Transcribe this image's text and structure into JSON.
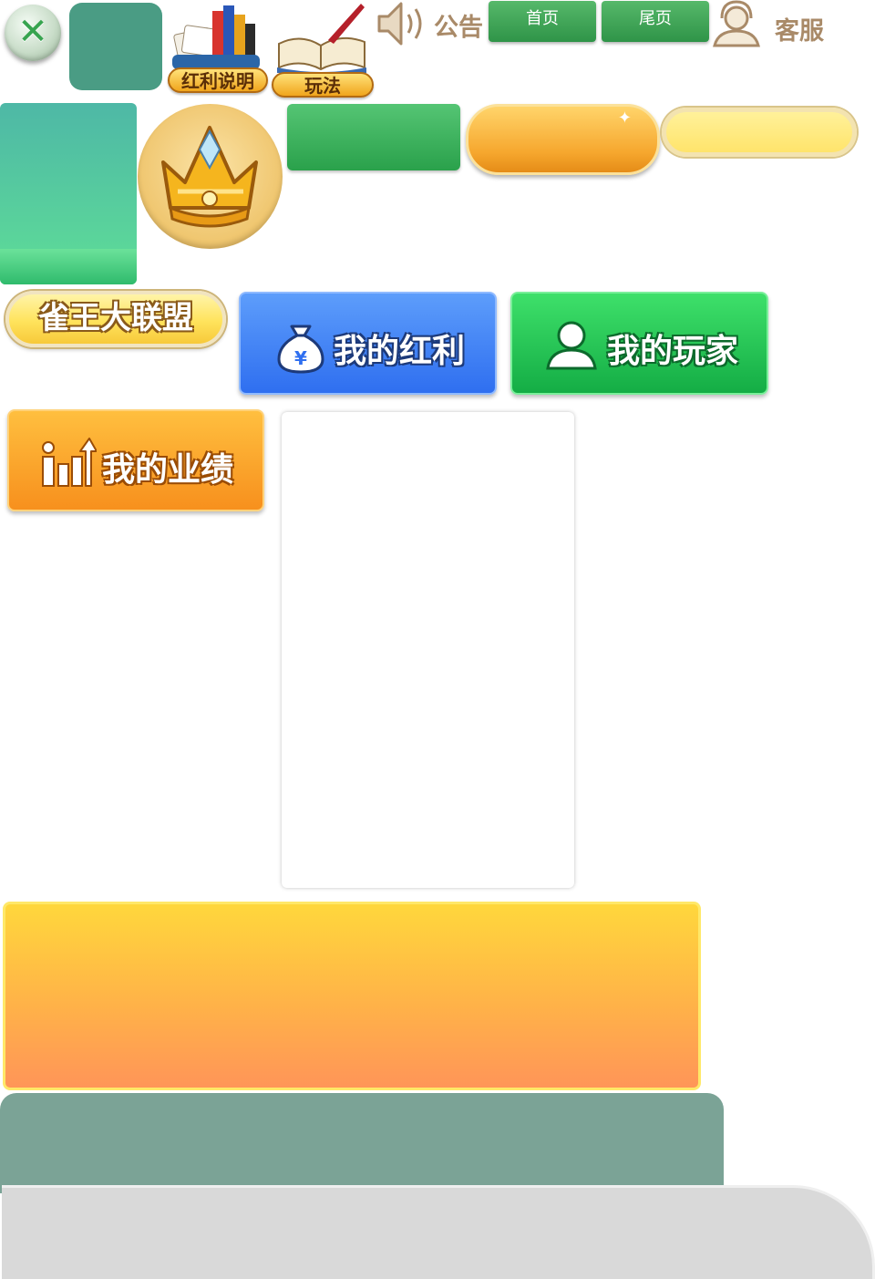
{
  "top_bar": {
    "close_icon_glyph": "✕",
    "bonus_info_label": "红利说明",
    "rules_label": "玩法",
    "notice_label": "公告",
    "home_label": "首页",
    "last_page_label": "尾页",
    "customer_service_label": "客服"
  },
  "alliance": {
    "label": "雀王大联盟"
  },
  "actions": {
    "my_bonus_label": "我的红利",
    "my_players_label": "我的玩家",
    "my_performance_label": "我的业绩"
  },
  "icons": {
    "close": "close-icon",
    "cards_chips": "cards-chips-icon",
    "book_quill": "book-quill-icon",
    "speaker": "speaker-icon",
    "customer_service": "headset-user-icon",
    "crown": "crown-icon",
    "money_bag": "money-bag-icon",
    "user": "user-icon",
    "chart_up": "growth-chart-icon"
  },
  "colors": {
    "nav_green": "#2f9448",
    "bonus_blue": "#2f6ff0",
    "players_green": "#14ad45",
    "performance_orange": "#f7901d",
    "teal": "#4a9c84",
    "sage": "#7ba396"
  }
}
